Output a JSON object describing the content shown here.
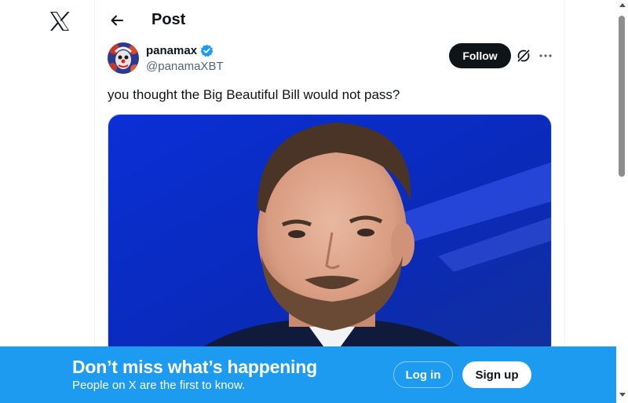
{
  "app": {
    "logo_icon": "x-logo-icon"
  },
  "header": {
    "title": "Post",
    "back_icon": "arrow-left-icon"
  },
  "post": {
    "author": {
      "name": "panamax",
      "handle": "@panamaXBT",
      "verified": true,
      "verified_color": "#1d9bf0"
    },
    "follow_label": "Follow",
    "grok_icon": "grok-icon",
    "more_icon": "more-dots-icon",
    "text": "you thought the Big Beautiful Bill would not pass?",
    "media": {
      "type": "photo"
    }
  },
  "banner": {
    "title": "Don’t miss what’s happening",
    "subtitle": "People on X are the first to know.",
    "login_label": "Log in",
    "signup_label": "Sign up",
    "background": "#1d9bf0"
  }
}
